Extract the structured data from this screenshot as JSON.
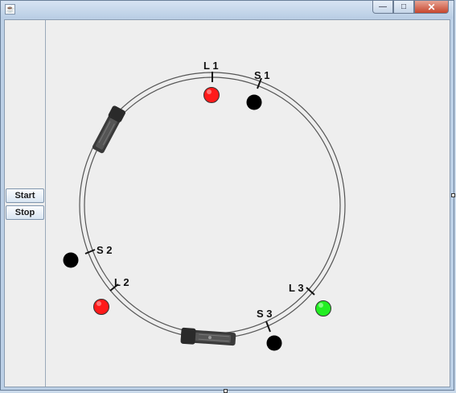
{
  "window": {
    "title": ""
  },
  "controls": {
    "start_label": "Start",
    "stop_label": "Stop"
  },
  "track_labels": {
    "l1": "L 1",
    "s1": "S 1",
    "s2": "S 2",
    "l2": "L 2",
    "l3": "L 3",
    "s3": "S 3"
  },
  "colors": {
    "red_light": "#ff1a1a",
    "green_light": "#22ee22",
    "sensor": "#000000",
    "track": "#555555"
  },
  "icons": {
    "minimize": "minimize-icon",
    "maximize": "maximize-icon",
    "close": "close-icon"
  }
}
